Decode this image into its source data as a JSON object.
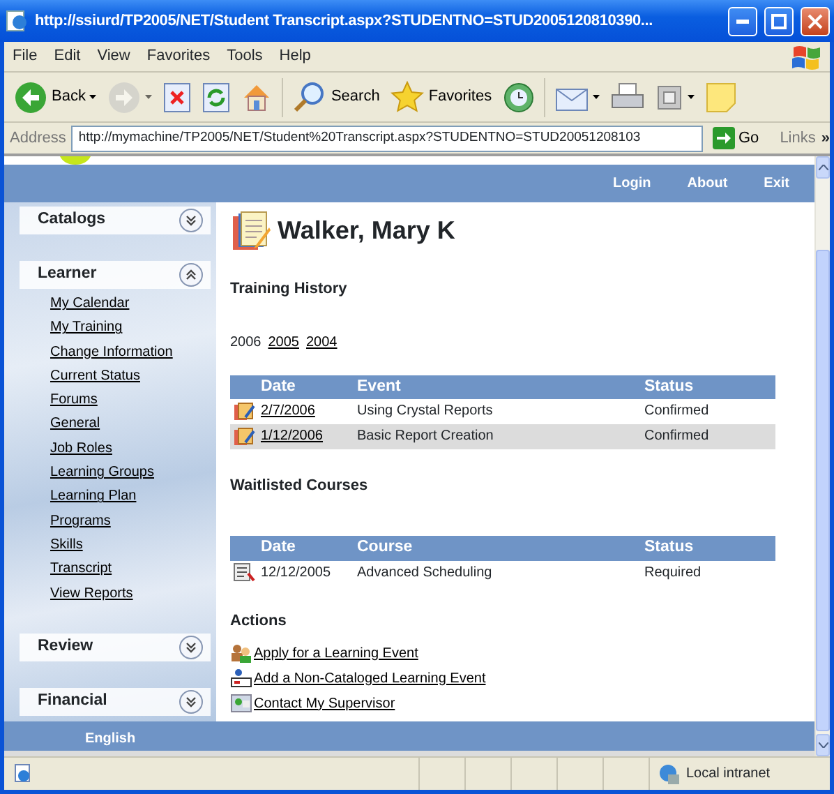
{
  "window": {
    "title": "http://ssiurd/TP2005/NET/Student Transcript.aspx?STUDENTNO=STUD2005120810390..."
  },
  "menu_bar": [
    "File",
    "Edit",
    "View",
    "Favorites",
    "Tools",
    "Help"
  ],
  "toolbar": [
    {
      "kind": "back",
      "label": "Back",
      "dropdown": true,
      "disabled": false
    },
    {
      "kind": "forward",
      "dropdown": true,
      "disabled": true
    },
    {
      "kind": "stop",
      "dropdown": false,
      "disabled": false
    },
    {
      "kind": "refresh",
      "dropdown": false,
      "disabled": false
    },
    {
      "kind": "home",
      "dropdown": false,
      "disabled": false
    },
    {
      "kind": "search",
      "label": "Search",
      "dropdown": false,
      "disabled": false
    },
    {
      "kind": "favorites",
      "label": "Favorites",
      "dropdown": false,
      "disabled": false
    },
    {
      "kind": "history",
      "dropdown": false,
      "disabled": false
    },
    {
      "kind": "mail",
      "dropdown": true,
      "disabled": false
    },
    {
      "kind": "print",
      "dropdown": false,
      "disabled": false
    },
    {
      "kind": "edit",
      "dropdown": true,
      "disabled": false
    },
    {
      "kind": "note",
      "dropdown": false,
      "disabled": false
    }
  ],
  "address_bar": {
    "label": "Address",
    "value": "http://mymachine/TP2005/NET/Student%20Transcript.aspx?STUDENTNO=STUD20051208103",
    "go": "Go",
    "links": "Links",
    "more": "»"
  },
  "header_links": [
    "Login",
    "About",
    "Exit"
  ],
  "sidebar": [
    {
      "title": "Catalogs",
      "expanded": false
    },
    {
      "title": "Learner",
      "expanded": true,
      "items": [
        "My Calendar",
        "My Training",
        "Change Information",
        "Current Status",
        "Forums",
        "General",
        "Job Roles",
        "Learning Groups",
        "Learning Plan",
        "Programs",
        "Skills",
        "Transcript",
        "View Reports"
      ]
    },
    {
      "title": "Review",
      "expanded": false
    },
    {
      "title": "Financial",
      "expanded": false
    }
  ],
  "footer": {
    "language": "English"
  },
  "content": {
    "name": "Walker, Mary K",
    "training_history": {
      "title": "Training History",
      "years": [
        {
          "label": "2006",
          "selected": true
        },
        {
          "label": "2005",
          "selected": false
        },
        {
          "label": "2004",
          "selected": false
        }
      ],
      "columns": [
        "Date",
        "Event",
        "Status"
      ],
      "rows": [
        {
          "date": "2/7/2006",
          "event": "Using Crystal Reports",
          "status": "Confirmed"
        },
        {
          "date": "1/12/2006",
          "event": "Basic Report Creation",
          "status": "Confirmed"
        }
      ]
    },
    "waitlisted": {
      "title": "Waitlisted Courses",
      "columns": [
        "Date",
        "Course",
        "Status"
      ],
      "rows": [
        {
          "date": "12/12/2005",
          "course": "Advanced Scheduling",
          "status": "Required"
        }
      ]
    },
    "actions": {
      "title": "Actions",
      "items": [
        {
          "kind": "apply",
          "label": "Apply for a Learning Event"
        },
        {
          "kind": "add",
          "label": "Add a Non-Cataloged Learning Event"
        },
        {
          "kind": "contact",
          "label": "Contact My Supervisor"
        }
      ]
    }
  },
  "status_bar": {
    "zone": "Local intranet"
  }
}
